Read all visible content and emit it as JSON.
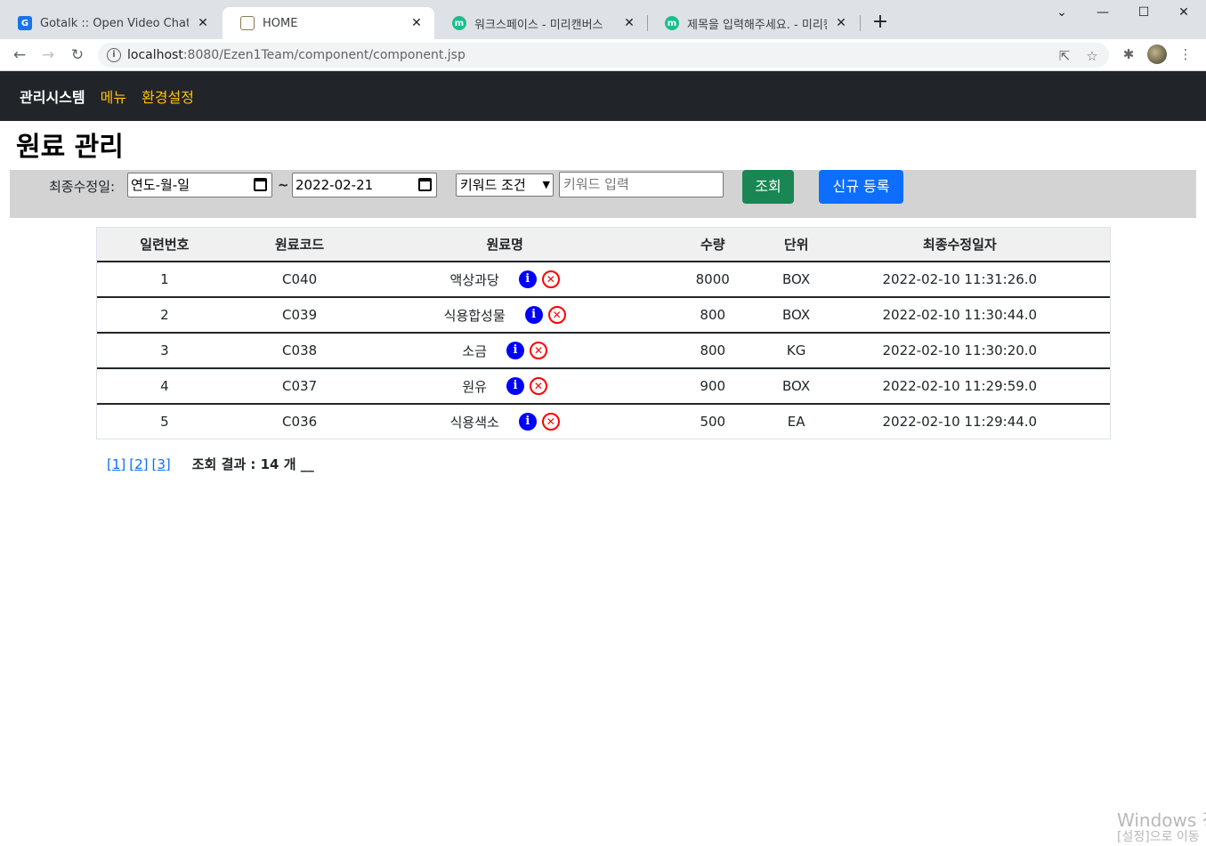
{
  "browser": {
    "tabs": [
      {
        "title": "Gotalk :: Open Video Chat",
        "favicon_color": "#1a73e8",
        "favicon_glyph": "G"
      },
      {
        "title": "HOME",
        "favicon_color": "#8a7a50",
        "favicon_glyph": ""
      },
      {
        "title": "워크스페이스 - 미리캔버스",
        "favicon_color": "#16c08e",
        "favicon_glyph": "m"
      },
      {
        "title": "제목을 입력해주세요. - 미리캔바",
        "favicon_color": "#16c08e",
        "favicon_glyph": "m"
      }
    ],
    "new_tab": "+",
    "url_host": "localhost",
    "url_rest": ":8080/Ezen1Team/component/component.jsp"
  },
  "navbar": {
    "brand": "관리시스템",
    "links": [
      "메뉴",
      "환경설정"
    ]
  },
  "page": {
    "title": "원료 관리"
  },
  "search": {
    "label": "최종수정일:",
    "date_from": "연도-월-일",
    "tilde": "~",
    "date_to": "2022-02-21",
    "select_value": "키워드 조건",
    "keyword_placeholder": "키워드 입력",
    "search_button": "조회",
    "new_button": "신규 등록"
  },
  "table": {
    "headers": [
      "일련번호",
      "원료코드",
      "원료명",
      "수량",
      "단위",
      "최종수정일자"
    ],
    "rows": [
      {
        "no": "1",
        "code": "C040",
        "name": "액상과당",
        "qty": "8000",
        "unit": "BOX",
        "date": "2022-02-10 11:31:26.0"
      },
      {
        "no": "2",
        "code": "C039",
        "name": "식용합성물",
        "qty": "800",
        "unit": "BOX",
        "date": "2022-02-10 11:30:44.0"
      },
      {
        "no": "3",
        "code": "C038",
        "name": "소금",
        "qty": "800",
        "unit": "KG",
        "date": "2022-02-10 11:30:20.0"
      },
      {
        "no": "4",
        "code": "C037",
        "name": "원유",
        "qty": "900",
        "unit": "BOX",
        "date": "2022-02-10 11:29:59.0"
      },
      {
        "no": "5",
        "code": "C036",
        "name": "식용색소",
        "qty": "500",
        "unit": "EA",
        "date": "2022-02-10 11:29:44.0"
      }
    ]
  },
  "pagination": {
    "pages": [
      "[1]",
      "[2]",
      "[3]"
    ],
    "result": "조회 결과 : 14 개 __"
  },
  "watermark": {
    "line1": "Windows 정",
    "line2": "[설정]으로 이동"
  }
}
